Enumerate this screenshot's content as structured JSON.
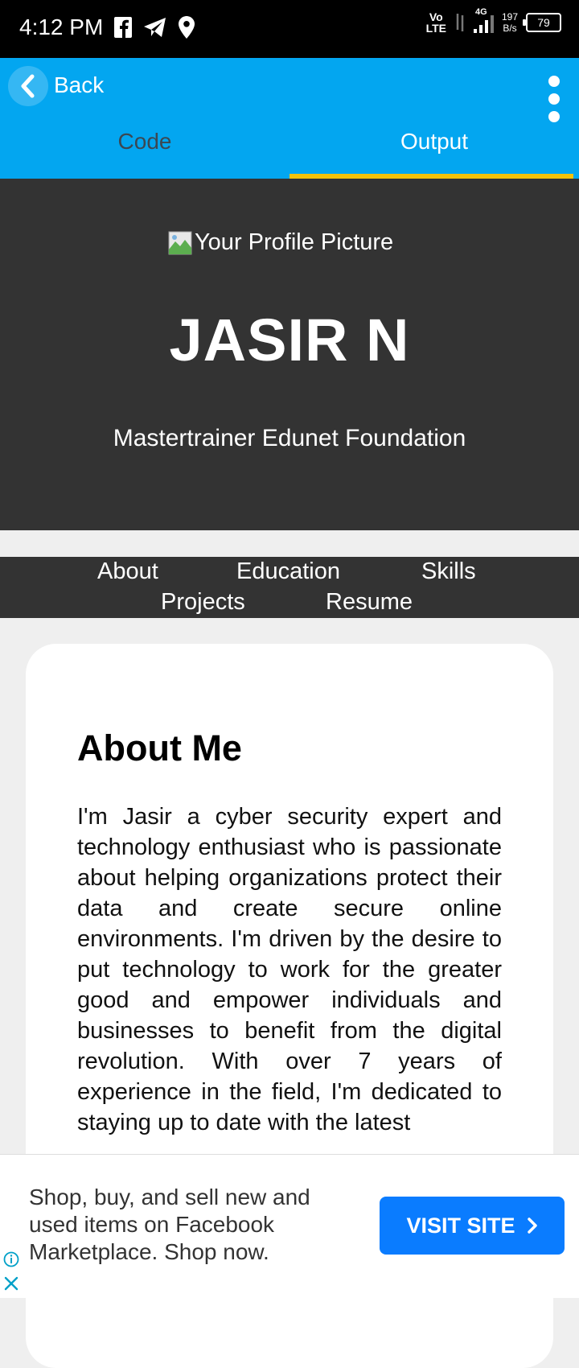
{
  "status_bar": {
    "time": "4:12 PM",
    "network_top": "Vo",
    "network_bottom": "LTE",
    "network_type": "4G",
    "speed_top": "197",
    "speed_bottom": "B/s",
    "battery": "79"
  },
  "app_bar": {
    "back_label": "Back",
    "tabs": [
      {
        "label": "Code",
        "active": false
      },
      {
        "label": "Output",
        "active": true
      }
    ]
  },
  "hero": {
    "profile_alt": "Your Profile Picture",
    "name": "JASIR N",
    "subtitle": "Mastertrainer Edunet Foundation"
  },
  "nav": {
    "items": [
      "About",
      "Education",
      "Skills",
      "Projects",
      "Resume"
    ]
  },
  "about": {
    "heading": "About Me",
    "text": "I'm Jasir a cyber security expert and technology enthusiast who is passionate about helping organizations protect their data and create secure online environments. I'm driven by the desire to put technology to work for the greater good and empower individuals and businesses to benefit from the digital revolution. With over 7 years of experience in the field, I'm dedicated to staying up to date with the latest"
  },
  "ad": {
    "text": "Shop, buy, and sell new and\nused items on Facebook\nMarketplace. Shop now.",
    "button_label": "VISIT SITE"
  },
  "colors": {
    "app_bar": "#03a6f0",
    "tab_indicator": "#f3c20a",
    "hero_bg": "#333333",
    "ad_button": "#0a7cff"
  }
}
